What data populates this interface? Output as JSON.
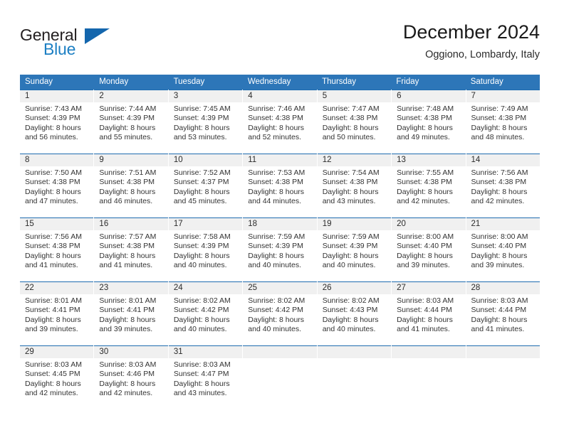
{
  "brand": {
    "name_top": "General",
    "name_bottom": "Blue",
    "triangle_icon": "triangle-logo-icon",
    "color_top": "#231f20",
    "color_bottom": "#1c7fc3",
    "color_triangle": "#1466ad"
  },
  "header": {
    "title": "December 2024",
    "subtitle": "Oggiono, Lombardy, Italy"
  },
  "theme": {
    "header_blue": "#2d76b8",
    "rule_blue": "#1f6cb0",
    "daynum_band": "#f0f0f0",
    "text": "#333333"
  },
  "calendar": {
    "weekday_headers": [
      "Sunday",
      "Monday",
      "Tuesday",
      "Wednesday",
      "Thursday",
      "Friday",
      "Saturday"
    ],
    "weeks": [
      [
        {
          "day": "1",
          "sunrise": "Sunrise: 7:43 AM",
          "sunset": "Sunset: 4:39 PM",
          "daylight1": "Daylight: 8 hours",
          "daylight2": "and 56 minutes."
        },
        {
          "day": "2",
          "sunrise": "Sunrise: 7:44 AM",
          "sunset": "Sunset: 4:39 PM",
          "daylight1": "Daylight: 8 hours",
          "daylight2": "and 55 minutes."
        },
        {
          "day": "3",
          "sunrise": "Sunrise: 7:45 AM",
          "sunset": "Sunset: 4:39 PM",
          "daylight1": "Daylight: 8 hours",
          "daylight2": "and 53 minutes."
        },
        {
          "day": "4",
          "sunrise": "Sunrise: 7:46 AM",
          "sunset": "Sunset: 4:38 PM",
          "daylight1": "Daylight: 8 hours",
          "daylight2": "and 52 minutes."
        },
        {
          "day": "5",
          "sunrise": "Sunrise: 7:47 AM",
          "sunset": "Sunset: 4:38 PM",
          "daylight1": "Daylight: 8 hours",
          "daylight2": "and 50 minutes."
        },
        {
          "day": "6",
          "sunrise": "Sunrise: 7:48 AM",
          "sunset": "Sunset: 4:38 PM",
          "daylight1": "Daylight: 8 hours",
          "daylight2": "and 49 minutes."
        },
        {
          "day": "7",
          "sunrise": "Sunrise: 7:49 AM",
          "sunset": "Sunset: 4:38 PM",
          "daylight1": "Daylight: 8 hours",
          "daylight2": "and 48 minutes."
        }
      ],
      [
        {
          "day": "8",
          "sunrise": "Sunrise: 7:50 AM",
          "sunset": "Sunset: 4:38 PM",
          "daylight1": "Daylight: 8 hours",
          "daylight2": "and 47 minutes."
        },
        {
          "day": "9",
          "sunrise": "Sunrise: 7:51 AM",
          "sunset": "Sunset: 4:38 PM",
          "daylight1": "Daylight: 8 hours",
          "daylight2": "and 46 minutes."
        },
        {
          "day": "10",
          "sunrise": "Sunrise: 7:52 AM",
          "sunset": "Sunset: 4:37 PM",
          "daylight1": "Daylight: 8 hours",
          "daylight2": "and 45 minutes."
        },
        {
          "day": "11",
          "sunrise": "Sunrise: 7:53 AM",
          "sunset": "Sunset: 4:38 PM",
          "daylight1": "Daylight: 8 hours",
          "daylight2": "and 44 minutes."
        },
        {
          "day": "12",
          "sunrise": "Sunrise: 7:54 AM",
          "sunset": "Sunset: 4:38 PM",
          "daylight1": "Daylight: 8 hours",
          "daylight2": "and 43 minutes."
        },
        {
          "day": "13",
          "sunrise": "Sunrise: 7:55 AM",
          "sunset": "Sunset: 4:38 PM",
          "daylight1": "Daylight: 8 hours",
          "daylight2": "and 42 minutes."
        },
        {
          "day": "14",
          "sunrise": "Sunrise: 7:56 AM",
          "sunset": "Sunset: 4:38 PM",
          "daylight1": "Daylight: 8 hours",
          "daylight2": "and 42 minutes."
        }
      ],
      [
        {
          "day": "15",
          "sunrise": "Sunrise: 7:56 AM",
          "sunset": "Sunset: 4:38 PM",
          "daylight1": "Daylight: 8 hours",
          "daylight2": "and 41 minutes."
        },
        {
          "day": "16",
          "sunrise": "Sunrise: 7:57 AM",
          "sunset": "Sunset: 4:38 PM",
          "daylight1": "Daylight: 8 hours",
          "daylight2": "and 41 minutes."
        },
        {
          "day": "17",
          "sunrise": "Sunrise: 7:58 AM",
          "sunset": "Sunset: 4:39 PM",
          "daylight1": "Daylight: 8 hours",
          "daylight2": "and 40 minutes."
        },
        {
          "day": "18",
          "sunrise": "Sunrise: 7:59 AM",
          "sunset": "Sunset: 4:39 PM",
          "daylight1": "Daylight: 8 hours",
          "daylight2": "and 40 minutes."
        },
        {
          "day": "19",
          "sunrise": "Sunrise: 7:59 AM",
          "sunset": "Sunset: 4:39 PM",
          "daylight1": "Daylight: 8 hours",
          "daylight2": "and 40 minutes."
        },
        {
          "day": "20",
          "sunrise": "Sunrise: 8:00 AM",
          "sunset": "Sunset: 4:40 PM",
          "daylight1": "Daylight: 8 hours",
          "daylight2": "and 39 minutes."
        },
        {
          "day": "21",
          "sunrise": "Sunrise: 8:00 AM",
          "sunset": "Sunset: 4:40 PM",
          "daylight1": "Daylight: 8 hours",
          "daylight2": "and 39 minutes."
        }
      ],
      [
        {
          "day": "22",
          "sunrise": "Sunrise: 8:01 AM",
          "sunset": "Sunset: 4:41 PM",
          "daylight1": "Daylight: 8 hours",
          "daylight2": "and 39 minutes."
        },
        {
          "day": "23",
          "sunrise": "Sunrise: 8:01 AM",
          "sunset": "Sunset: 4:41 PM",
          "daylight1": "Daylight: 8 hours",
          "daylight2": "and 39 minutes."
        },
        {
          "day": "24",
          "sunrise": "Sunrise: 8:02 AM",
          "sunset": "Sunset: 4:42 PM",
          "daylight1": "Daylight: 8 hours",
          "daylight2": "and 40 minutes."
        },
        {
          "day": "25",
          "sunrise": "Sunrise: 8:02 AM",
          "sunset": "Sunset: 4:42 PM",
          "daylight1": "Daylight: 8 hours",
          "daylight2": "and 40 minutes."
        },
        {
          "day": "26",
          "sunrise": "Sunrise: 8:02 AM",
          "sunset": "Sunset: 4:43 PM",
          "daylight1": "Daylight: 8 hours",
          "daylight2": "and 40 minutes."
        },
        {
          "day": "27",
          "sunrise": "Sunrise: 8:03 AM",
          "sunset": "Sunset: 4:44 PM",
          "daylight1": "Daylight: 8 hours",
          "daylight2": "and 41 minutes."
        },
        {
          "day": "28",
          "sunrise": "Sunrise: 8:03 AM",
          "sunset": "Sunset: 4:44 PM",
          "daylight1": "Daylight: 8 hours",
          "daylight2": "and 41 minutes."
        }
      ],
      [
        {
          "day": "29",
          "sunrise": "Sunrise: 8:03 AM",
          "sunset": "Sunset: 4:45 PM",
          "daylight1": "Daylight: 8 hours",
          "daylight2": "and 42 minutes."
        },
        {
          "day": "30",
          "sunrise": "Sunrise: 8:03 AM",
          "sunset": "Sunset: 4:46 PM",
          "daylight1": "Daylight: 8 hours",
          "daylight2": "and 42 minutes."
        },
        {
          "day": "31",
          "sunrise": "Sunrise: 8:03 AM",
          "sunset": "Sunset: 4:47 PM",
          "daylight1": "Daylight: 8 hours",
          "daylight2": "and 43 minutes."
        },
        {
          "day": "",
          "sunrise": "",
          "sunset": "",
          "daylight1": "",
          "daylight2": ""
        },
        {
          "day": "",
          "sunrise": "",
          "sunset": "",
          "daylight1": "",
          "daylight2": ""
        },
        {
          "day": "",
          "sunrise": "",
          "sunset": "",
          "daylight1": "",
          "daylight2": ""
        },
        {
          "day": "",
          "sunrise": "",
          "sunset": "",
          "daylight1": "",
          "daylight2": ""
        }
      ]
    ]
  }
}
